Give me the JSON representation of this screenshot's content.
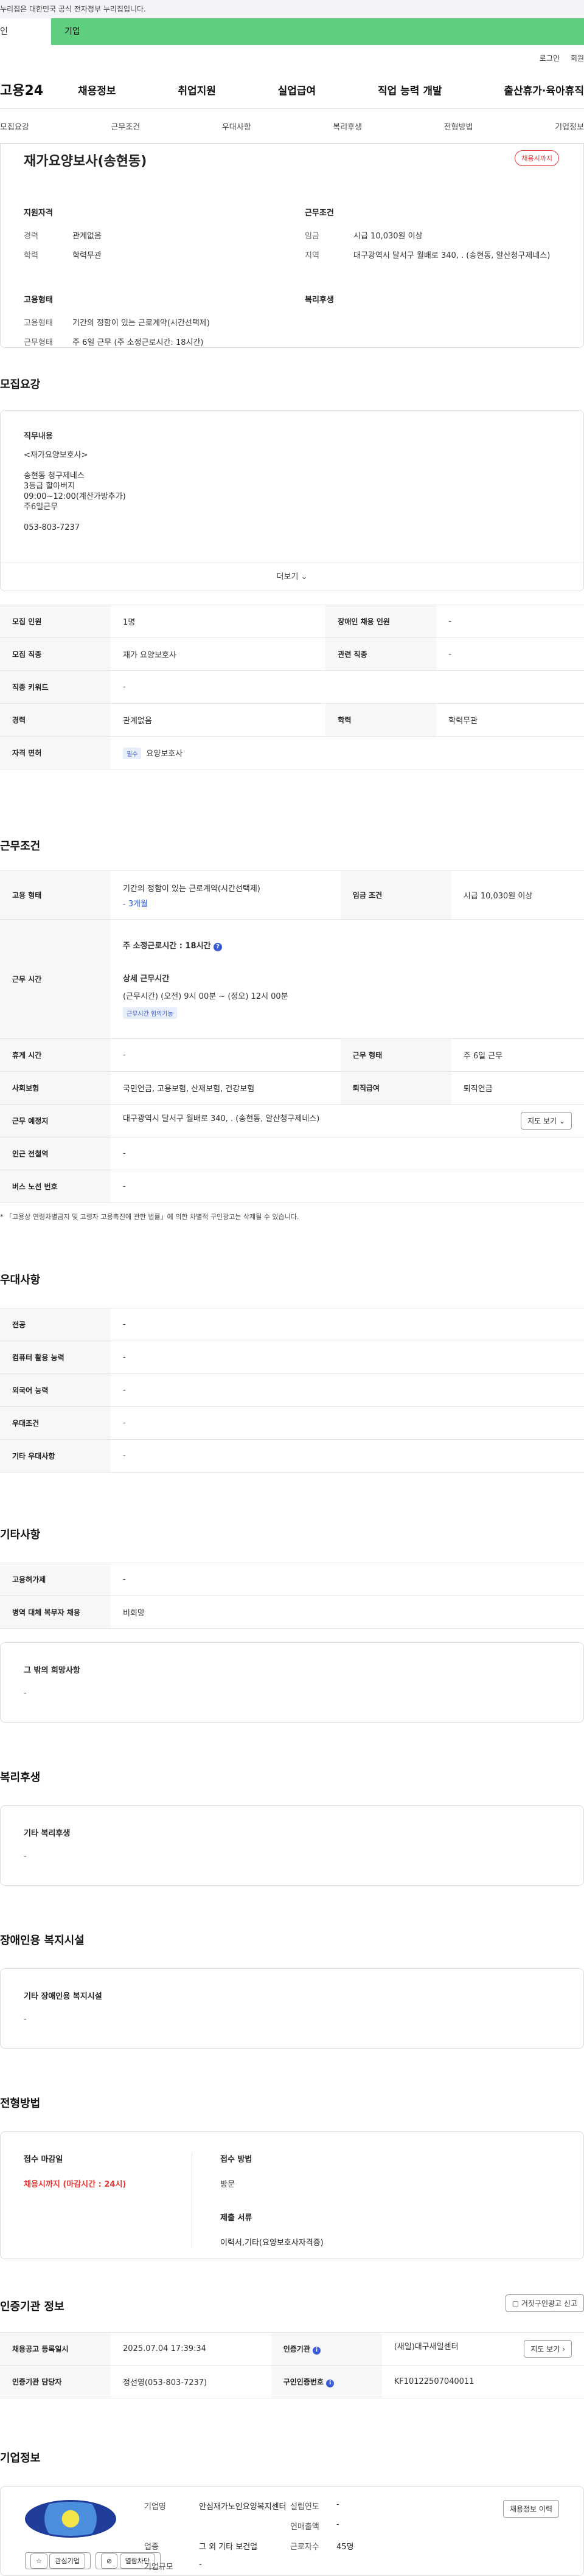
{
  "banner": {
    "text": "누리집은 대한민국 공식 전자정부 누리집입니다."
  },
  "top_tabs": [
    "인",
    "기업"
  ],
  "util": {
    "login": "로그인",
    "join": "회원"
  },
  "logo": "고용24",
  "gnb": [
    "채용정보",
    "취업지원",
    "실업급여",
    "직업 능력 개발",
    "출산휴가·육아휴직"
  ],
  "lnb": [
    "모집요강",
    "근무조건",
    "우대사항",
    "복리후생",
    "전형방법",
    "기업정보"
  ],
  "summary": {
    "title": "재가요양보사(송현동)",
    "badge": "채용시까지",
    "qual_title": "지원자격",
    "cond_title": "근무조건",
    "career_k": "경력",
    "career_v": "관계없음",
    "edu_k": "학력",
    "edu_v": "학력무관",
    "wage_k": "임금",
    "wage_v": "시급 10,030원 이상",
    "region_k": "지역",
    "region_v": "대구광역시 달서구 월배로 340, . (송현동, 알산청구제네스)",
    "emp_title": "고용형태",
    "welfare_title": "복리후생",
    "emptype_k": "고용형태",
    "emptype_v": "기간의 정함이 있는 근로계약(시간선택제)",
    "worktype_k": "근무형태",
    "worktype_v": "주 6일 근무 (주 소정근로시간: 18시간)"
  },
  "recruit": {
    "title": "모집요강",
    "desc_h": "직무내용",
    "desc_lines": [
      "<재가요양보호사>",
      "",
      "송현동 청구제네스",
      "3등급 할아버지",
      "09:00~12:00(계산가방추가)",
      "주6일근무",
      "",
      "053-803-7237"
    ],
    "more": "더보기",
    "rows": [
      {
        "k1": "모집 인원",
        "v1": "1명",
        "k2": "장애인 채용 인원",
        "v2": "-"
      },
      {
        "k1": "모집 직종",
        "v1": "재가 요양보호사",
        "k2": "관련 직종",
        "v2": "-"
      },
      {
        "k1": "직종 키워드",
        "v1": "-"
      },
      {
        "k1": "경력",
        "v1": "관계없음",
        "k2": "학력",
        "v2": "학력무관"
      },
      {
        "k1": "자격 면허",
        "pill": "필수",
        "v1": "요양보호사"
      }
    ]
  },
  "work": {
    "title": "근무조건",
    "emp_k": "고용 형태",
    "emp_v": "기간의 정함이 있는 근로계약(시간선택제)",
    "emp_v2": "- 3개월",
    "wage_k": "임금 조건",
    "wage_v": "시급 10,030원 이상",
    "time_k": "근무 시간",
    "time_main": "주 소정근로시간 : 18시간",
    "time_detail_h": "상세 근무시간",
    "time_detail": "(근무시간) (오전) 9시 00분 ~ (정오) 12시 00분",
    "time_tag": "근무시간 협의가능",
    "rest_k": "휴게 시간",
    "rest_v": "-",
    "form_k": "근무 형태",
    "form_v": "주 6일 근무",
    "ins_k": "사회보험",
    "ins_v": "국민연금, 고용보험, 산재보험, 건강보험",
    "ret_k": "퇴직급여",
    "ret_v": "퇴직연금",
    "place_k": "근무 예정지",
    "place_v": "대구광역시 달서구 월배로 340, . (송현동, 알산청구제네스)",
    "map_btn": "지도 보기",
    "sub_k": "인근 전철역",
    "sub_v": "-",
    "bus_k": "버스 노선 번호",
    "bus_v": "-",
    "note": "* 「고용상 연령차별금지 및 고령자 고용촉진에 관한 법률」에 의한 차별적 구인광고는 삭제될 수 있습니다."
  },
  "pref": {
    "title": "우대사항",
    "rows": [
      {
        "k": "전공",
        "v": "-"
      },
      {
        "k": "컴퓨터 활용 능력",
        "v": "-"
      },
      {
        "k": "외국어 능력",
        "v": "-"
      },
      {
        "k": "우대조건",
        "v": "-"
      },
      {
        "k": "기타 우대사항",
        "v": "-"
      }
    ]
  },
  "etc": {
    "title": "기타사항",
    "rows": [
      {
        "k": "고용허가제",
        "v": "-"
      },
      {
        "k": "병역 대체 복무자 채용",
        "v": "비희망"
      }
    ],
    "box_h": "그 밖의 희망사항",
    "box_v": "-"
  },
  "welfare": {
    "title": "복리후생",
    "box_h": "기타 복리후생",
    "box_v": "-"
  },
  "disabled": {
    "title": "장애인용 복지시설",
    "box_h": "기타 장애인용 복지시설",
    "box_v": "-"
  },
  "apply": {
    "title": "전형방법",
    "deadline_h": "접수 마감일",
    "deadline_v": "채용시까지 (마감시간 : 24시)",
    "method_h": "접수 방법",
    "method_v": "방문",
    "docs_h": "제출 서류",
    "docs_v": "이력서,기타(요양보호사자격증)"
  },
  "cert": {
    "title": "인증기관 정보",
    "report_btn": "거짓구인광고 신고",
    "reg_k": "채용공고 등록일시",
    "reg_v": "2025.07.04 17:39:34",
    "org_k": "인증기관",
    "org_v": "(새일)대구새일센터",
    "org_btn": "지도 보기",
    "mgr_k": "인증기관 담당자",
    "mgr_v": "정선영(053-803-7237)",
    "num_k": "구인인증번호",
    "num_v": "KF10122507040011"
  },
  "company": {
    "title": "기업정보",
    "fav_btn": "관심기업",
    "block_btn": "열람차단",
    "name_k": "기업명",
    "name_v": "안심재가노인요양복지센터",
    "found_k": "설립연도",
    "found_v": "-",
    "sales_k": "연매출액",
    "sales_v": "-",
    "ind_k": "업종",
    "ind_v": "그 외 기타 보건업",
    "emp_k": "근로자수",
    "emp_v": "45명",
    "size_k": "기업규모",
    "size_v": "-",
    "hist_btn": "채용정보 이력"
  }
}
